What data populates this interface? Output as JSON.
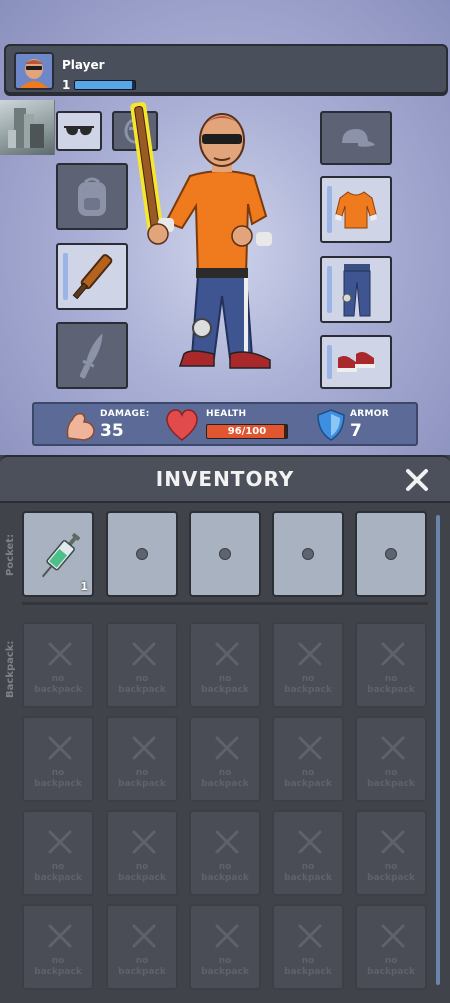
{
  "player": {
    "name": "Player",
    "level": "1",
    "xp_progress": 0.95
  },
  "stats": {
    "damage_label": "DAMAGE:",
    "damage_value": "35",
    "health_label": "HEALTH",
    "health_text": "96/100",
    "health_current": 96,
    "health_max": 100,
    "armor_label": "ARMOR",
    "armor_value": "7"
  },
  "equipment": {
    "left": [
      "sunglasses",
      "mask",
      "backpack",
      "cricket-bat",
      "knife"
    ],
    "right": [
      "cap",
      "orange-shirt",
      "jeans",
      "sneakers"
    ]
  },
  "inventory": {
    "title": "INVENTORY",
    "pocket_label": "Pocket:",
    "backpack_label": "Backpack:",
    "pocket_items": [
      {
        "icon": "syringe",
        "qty": "1"
      },
      {
        "icon": "empty"
      },
      {
        "icon": "empty"
      },
      {
        "icon": "empty"
      },
      {
        "icon": "empty"
      }
    ],
    "no_backpack_text": "no\nbackpack",
    "no_backpack_line1": "no",
    "no_backpack_line2": "backpack"
  },
  "colors": {
    "accent_blue": "#5aa7e8",
    "health_red": "#e2562f",
    "shirt_orange": "#f07a1e",
    "bat_highlight": "#f7e62e"
  }
}
